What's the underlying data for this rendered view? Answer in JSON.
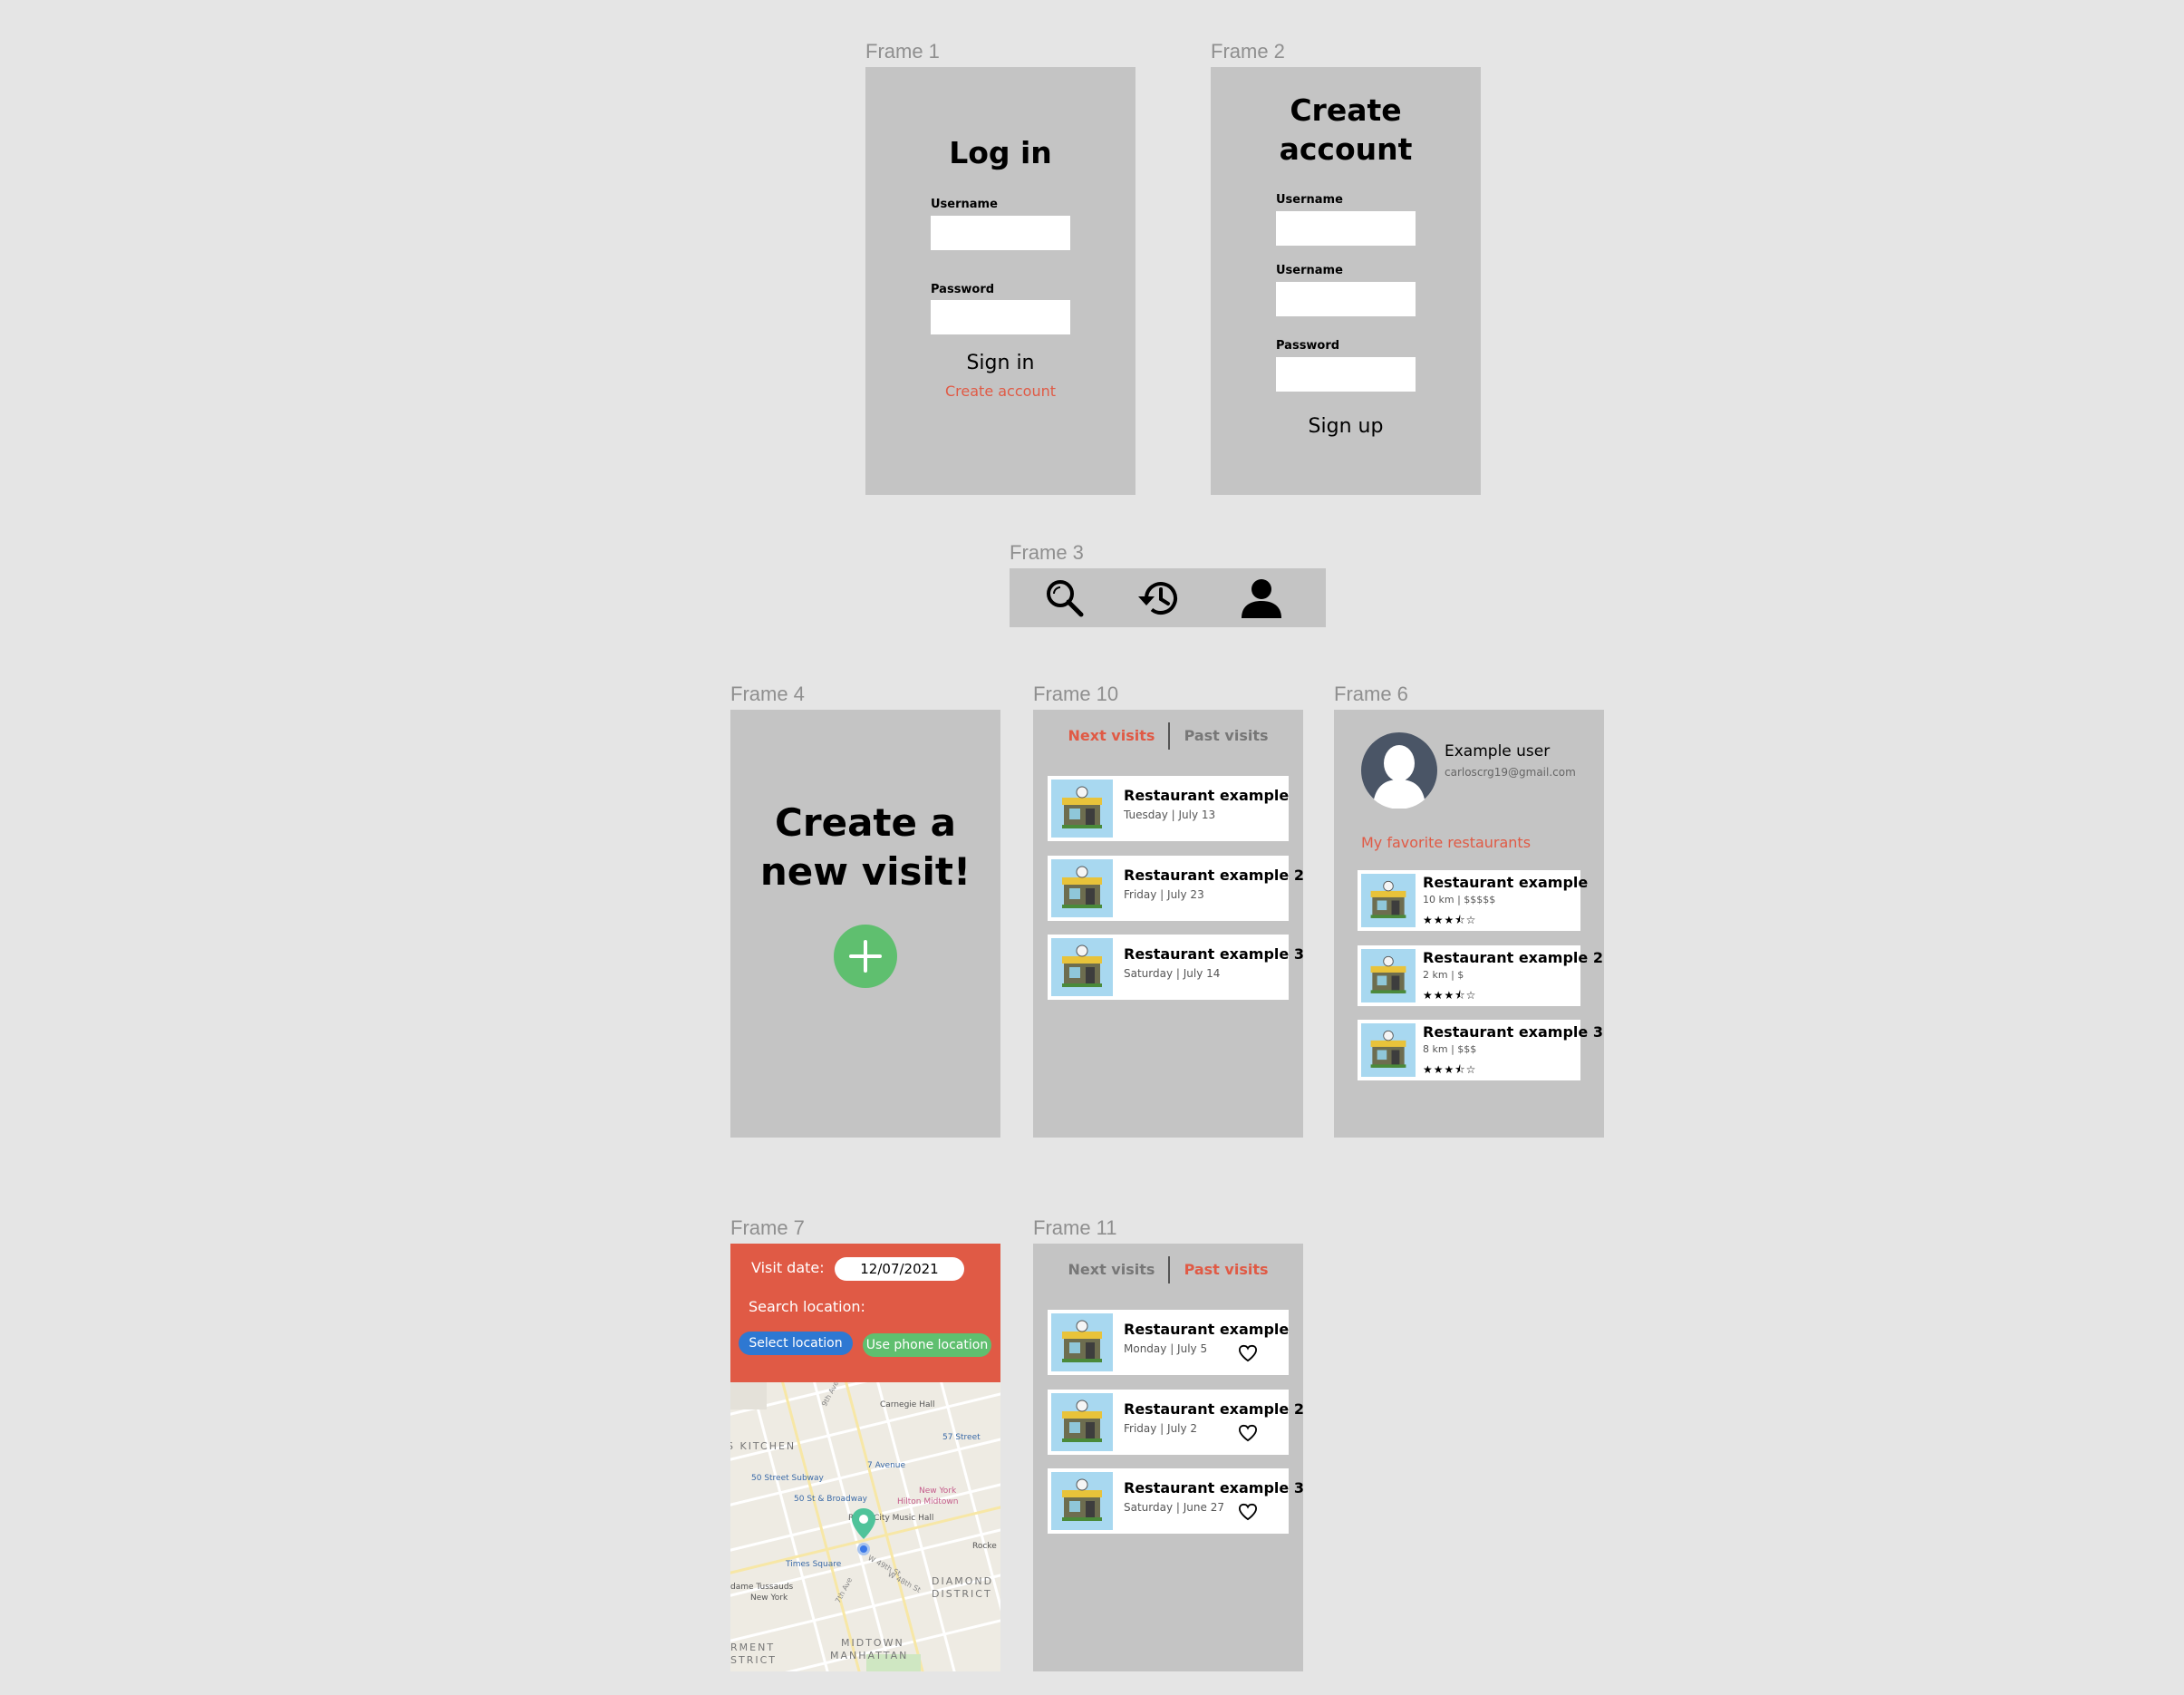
{
  "frames": {
    "frame1": "Frame 1",
    "frame2": "Frame 2",
    "frame3": "Frame 3",
    "frame4": "Frame 4",
    "frame10": "Frame 10",
    "frame6": "Frame 6",
    "frame7": "Frame 7",
    "frame11": "Frame 11"
  },
  "login": {
    "title": "Log in",
    "username_label": "Username",
    "password_label": "Password",
    "username_value": "",
    "password_value": "",
    "sign_in": "Sign in",
    "create_account": "Create account"
  },
  "signup": {
    "title_line1": "Create",
    "title_line2": "account",
    "field1_label": "Username",
    "field2_label": "Username",
    "field3_label": "Password",
    "sign_up": "Sign up"
  },
  "navbar": {
    "icons": [
      "search-icon",
      "history-icon",
      "user-icon"
    ]
  },
  "new_visit": {
    "title_line1": "Create a",
    "title_line2": "new visit!",
    "accent": "#5fbf6f"
  },
  "next_visits": {
    "tab_next": "Next visits",
    "tab_past": "Past visits",
    "items": [
      {
        "name": "Restaurant example",
        "date": "Tuesday | July 13"
      },
      {
        "name": "Restaurant example 2",
        "date": "Friday | July 23"
      },
      {
        "name": "Restaurant example 3",
        "date": "Saturday | July 14"
      }
    ]
  },
  "profile": {
    "user_name": "Example user",
    "email": "carloscrg19@gmail.com",
    "favorites_title": "My favorite restaurants",
    "favorites": [
      {
        "name": "Restaurant example",
        "meta": "10 km | $$$$$",
        "stars": "★★★⯪☆",
        "rating": 3.5
      },
      {
        "name": "Restaurant example 2",
        "meta": "2 km | $",
        "stars": "★★★⯪☆",
        "rating": 3.5
      },
      {
        "name": "Restaurant example 3",
        "meta": "8 km | $$$",
        "stars": "★★★⯪☆",
        "rating": 3.5
      }
    ]
  },
  "visit_form": {
    "visit_date_label": "Visit date:",
    "visit_date_value": "12/07/2021",
    "search_location_label": "Search location:",
    "select_location": "Select location",
    "use_phone_location": "Use phone location",
    "header_color": "#e05a45",
    "select_color": "#2e78d2",
    "phone_color": "#5fbf6f",
    "map_labels": {
      "kitchen": "S KITCHEN",
      "carnegie": "Carnegie Hall",
      "st57": "57 Street",
      "ave7": "7 Avenue",
      "st50subway": "50 Street Subway",
      "st50broadway": "50 St & Broadway",
      "hilton1": "New York",
      "hilton2": "Hilton Midtown",
      "radio": "Radio City Music Hall",
      "rocke": "Rocke",
      "times": "Times Square",
      "diamond1": "DIAMOND",
      "diamond2": "DISTRICT",
      "tussauds1": "dame Tussauds",
      "tussauds2": "New York",
      "midtown1": "MIDTOWN",
      "midtown2": "MANHATTAN",
      "garment1": "RMENT",
      "garment2": "STRICT",
      "ave9": "9th Ave",
      "ave7th": "7th Ave",
      "w49": "W 49th St",
      "w48": "W 48th St"
    }
  },
  "past_visits": {
    "tab_next": "Next visits",
    "tab_past": "Past visits",
    "items": [
      {
        "name": "Restaurant example",
        "date": "Monday | July 5"
      },
      {
        "name": "Restaurant example 2",
        "date": "Friday | July 2"
      },
      {
        "name": "Restaurant example 3",
        "date": "Saturday | June 27"
      }
    ]
  }
}
